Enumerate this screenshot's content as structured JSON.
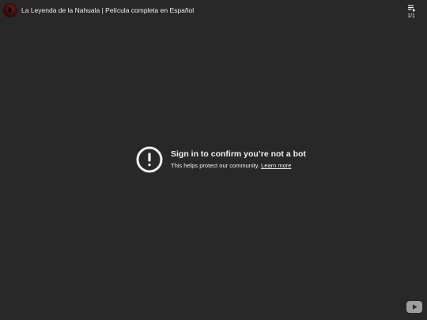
{
  "top_bar": {
    "channel_avatar_icon": "channel-avatar",
    "video_title": "La Leyenda de la Nahuala | Película completa en Español",
    "playlist": {
      "icon": "playlist-icon",
      "count": "1/1"
    }
  },
  "error": {
    "icon": "exclamation-circle-icon",
    "heading": "Sign in to confirm you’re not a bot",
    "message": "This helps protect our community.",
    "link_label": "Learn more"
  },
  "footer": {
    "logo_icon": "youtube-logo-icon"
  },
  "colors": {
    "background": "#282828",
    "text": "#f1f1f1",
    "logo_button": "#9e9e9e"
  }
}
